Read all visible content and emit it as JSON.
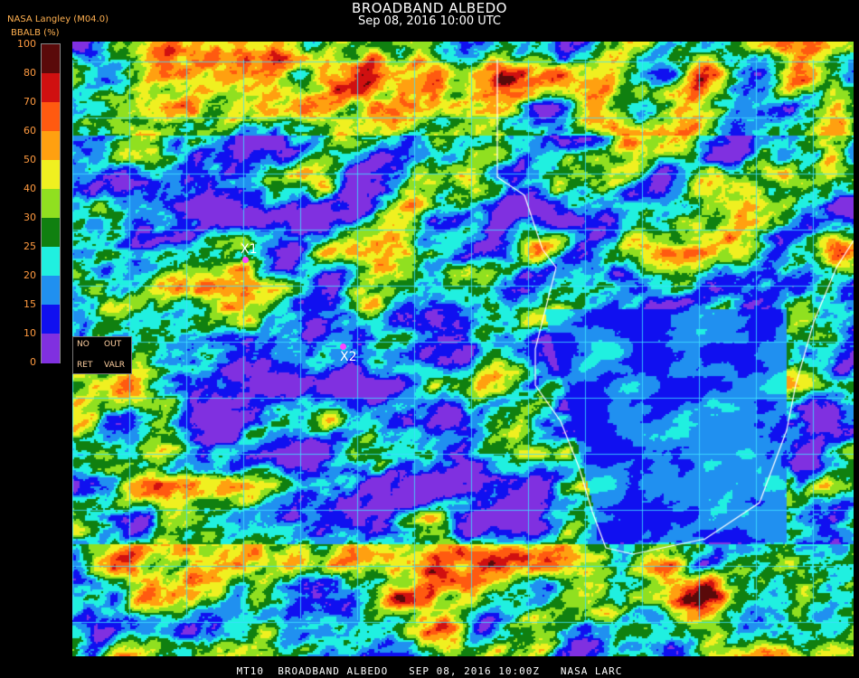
{
  "header": {
    "title": "BROADBAND ALBEDO",
    "datetime": "Sep 08, 2016 10:00 UTC",
    "organization": "NASA Langley (M04.0)",
    "legend_unit": "BBALB (%)"
  },
  "legend": {
    "ticks": [
      "100",
      "80",
      "70",
      "60",
      "50",
      "40",
      "30",
      "25",
      "20",
      "15",
      "10",
      "0"
    ],
    "colors": [
      "#5a0a0a",
      "#d01010",
      "#ff5a10",
      "#ffa010",
      "#f0f020",
      "#90e020",
      "#108010",
      "#20f0e0",
      "#2090f0",
      "#1010f0",
      "#8030e0"
    ]
  },
  "nodata_box": {
    "no": "NO",
    "out": "OUT",
    "ret": "RET",
    "valr": "VALR"
  },
  "markers": [
    {
      "label": "X1"
    },
    {
      "label": "X2"
    }
  ],
  "footer": "MT10  BROADBAND ALBEDO   SEP 08, 2016 10:00Z   NASA LARC",
  "colors": {
    "background": "#000000",
    "grid": "#40e0ff",
    "coast": "#ffffff",
    "marker_dot": "#ff44ff"
  }
}
